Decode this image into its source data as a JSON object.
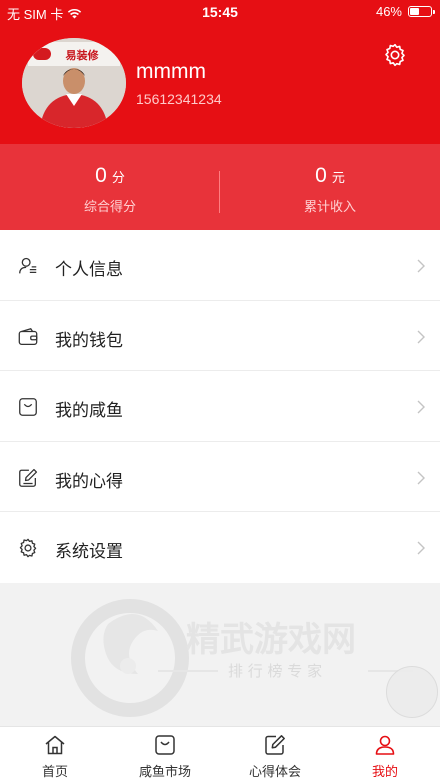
{
  "status_bar": {
    "carrier": "无 SIM 卡",
    "time": "15:45",
    "battery_text": "46%",
    "battery_level": 0.46
  },
  "profile": {
    "username": "mmmm",
    "phone": "15612341234",
    "avatar_sign_text": "易装修"
  },
  "stats": [
    {
      "value": "0",
      "unit": "分",
      "label": "综合得分"
    },
    {
      "value": "0",
      "unit": "元",
      "label": "累计收入"
    }
  ],
  "menu": [
    {
      "label": "个人信息",
      "icon": "user-info-icon"
    },
    {
      "label": "我的钱包",
      "icon": "wallet-icon"
    },
    {
      "label": "我的咸鱼",
      "icon": "bag-icon"
    },
    {
      "label": "我的心得",
      "icon": "edit-note-icon"
    },
    {
      "label": "系统设置",
      "icon": "gear-icon"
    }
  ],
  "watermark": {
    "title": "精武游戏网",
    "subtitle": "排 行 榜 专 家"
  },
  "tabbar": [
    {
      "label": "首页",
      "icon": "home-icon",
      "active": false
    },
    {
      "label": "咸鱼市场",
      "icon": "bag-icon",
      "active": false
    },
    {
      "label": "心得体会",
      "icon": "edit-note-icon",
      "active": false
    },
    {
      "label": "我的",
      "icon": "user-icon",
      "active": true
    }
  ],
  "colors": {
    "brand_red": "#e60f14",
    "stats_red": "#e8333a",
    "active_tab": "#e60f14"
  }
}
